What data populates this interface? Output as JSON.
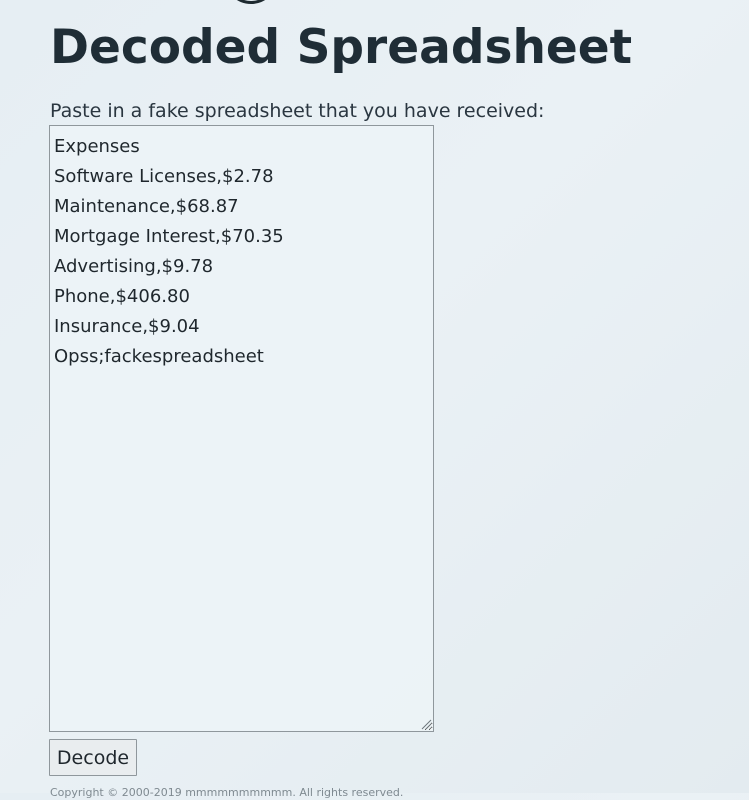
{
  "header": {
    "title": "Decoded Spreadsheet"
  },
  "form": {
    "prompt": "Paste in a fake spreadsheet that you have received:",
    "sheet_value": "Expenses\nSoftware Licenses,$2.78\nMaintenance,$68.87\nMortgage Interest,$70.35\nAdvertising,$9.78\nPhone,$406.80\nInsurance,$9.04\nOpss;fackespreadsheet",
    "decode_label": "Decode"
  },
  "footer": {
    "copyright": "Copyright © 2000-2019 mmmmmmmmmm. All rights reserved."
  }
}
